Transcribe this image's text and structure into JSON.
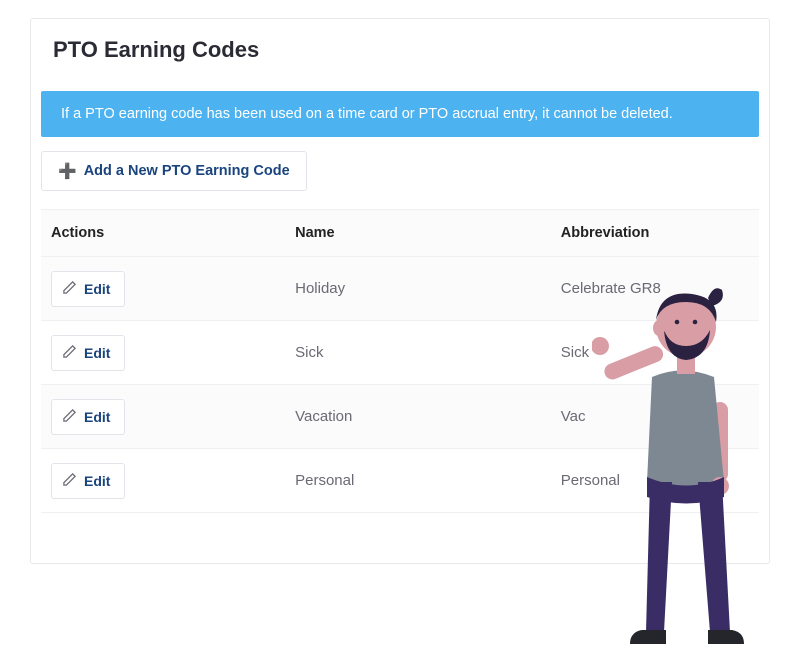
{
  "page": {
    "title": "PTO Earning Codes",
    "info_banner": "If a PTO earning code has been used on a time card or PTO accrual entry, it cannot be deleted.",
    "add_button_label": "Add a New PTO Earning Code"
  },
  "table": {
    "headers": {
      "actions": "Actions",
      "name": "Name",
      "abbreviation": "Abbreviation"
    },
    "edit_label": "Edit",
    "rows": [
      {
        "name": "Holiday",
        "abbreviation": "Celebrate GR8"
      },
      {
        "name": "Sick",
        "abbreviation": "Sick"
      },
      {
        "name": "Vacation",
        "abbreviation": "Vac"
      },
      {
        "name": "Personal",
        "abbreviation": "Personal"
      }
    ]
  },
  "colors": {
    "banner_bg": "#4db2f0",
    "link": "#1a447e"
  }
}
